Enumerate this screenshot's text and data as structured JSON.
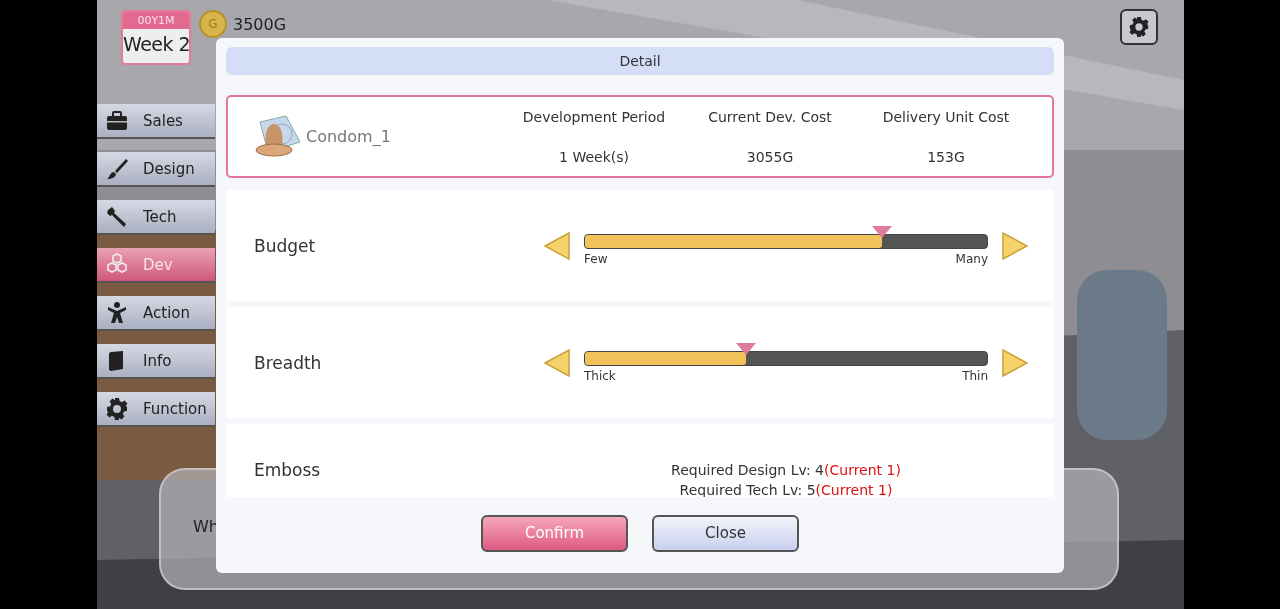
{
  "hud": {
    "period": "00Y1M",
    "week": "Week 2",
    "money": "3500G",
    "coin_symbol": "G"
  },
  "sidebar": {
    "items": [
      {
        "label": "Sales",
        "selected": false
      },
      {
        "label": "Design",
        "selected": false
      },
      {
        "label": "Tech",
        "selected": false
      },
      {
        "label": "Dev",
        "selected": true
      },
      {
        "label": "Action",
        "selected": false
      },
      {
        "label": "Info",
        "selected": false
      },
      {
        "label": "Function",
        "selected": false
      }
    ]
  },
  "message_box": {
    "text": "Wh"
  },
  "dialog": {
    "title": "Detail",
    "product": {
      "name": "Condom_1",
      "stats": [
        {
          "label": "Development Period",
          "value": "1 Week(s)"
        },
        {
          "label": "Current Dev. Cost",
          "value": "3055G"
        },
        {
          "label": "Delivery Unit Cost",
          "value": "153G"
        }
      ]
    },
    "rows": [
      {
        "kind": "slider",
        "label": "Budget",
        "level": 0.74,
        "min_label": "Few",
        "max_label": "Many"
      },
      {
        "kind": "slider",
        "label": "Breadth",
        "level": 0.4,
        "min_label": "Thick",
        "max_label": "Thin"
      },
      {
        "kind": "requirement",
        "label": "Emboss",
        "lines": [
          {
            "text": "Required Design Lv: 4",
            "current": "(Current 1)"
          },
          {
            "text": "Required Tech Lv: 5",
            "current": "(Current 1)"
          }
        ]
      }
    ],
    "buttons": [
      {
        "label": "Confirm",
        "kind": "primary"
      },
      {
        "label": "Close",
        "kind": "secondary"
      }
    ]
  }
}
